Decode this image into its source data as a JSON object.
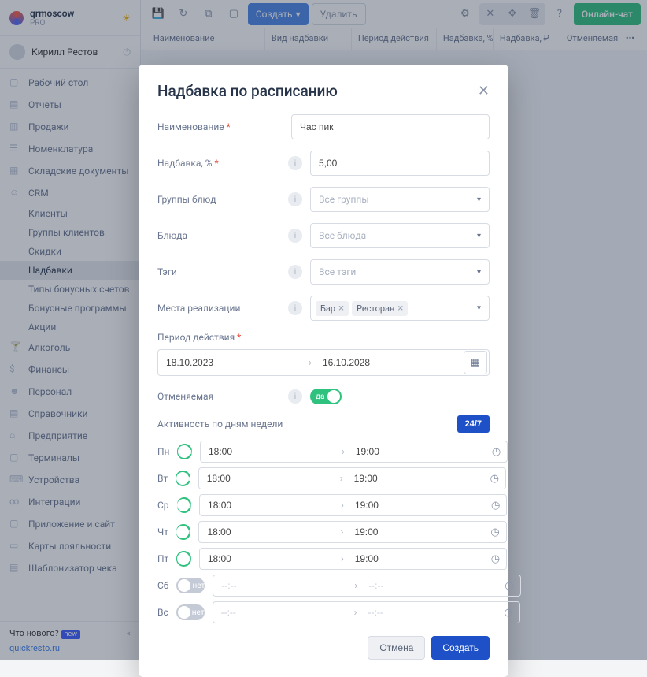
{
  "header": {
    "account": "qrmoscow",
    "plan": "PRO",
    "user": "Кирилл Рестов"
  },
  "nav": {
    "items": [
      {
        "label": "Рабочий стол"
      },
      {
        "label": "Отчеты"
      },
      {
        "label": "Продажи"
      },
      {
        "label": "Номенклатура"
      },
      {
        "label": "Складские документы"
      },
      {
        "label": "CRM"
      },
      {
        "label": "Алкоголь"
      },
      {
        "label": "Финансы"
      },
      {
        "label": "Персонал"
      },
      {
        "label": "Справочники"
      },
      {
        "label": "Предприятие"
      },
      {
        "label": "Терминалы"
      },
      {
        "label": "Устройства"
      },
      {
        "label": "Интеграции"
      },
      {
        "label": "Приложение и сайт"
      },
      {
        "label": "Карты лояльности"
      },
      {
        "label": "Шаблонизатор чека"
      }
    ],
    "crm_sub": [
      {
        "label": "Клиенты"
      },
      {
        "label": "Группы клиентов"
      },
      {
        "label": "Скидки"
      },
      {
        "label": "Надбавки"
      },
      {
        "label": "Типы бонусных счетов"
      },
      {
        "label": "Бонусные программы"
      },
      {
        "label": "Акции"
      }
    ]
  },
  "footer": {
    "whatsnew": "Что нового?",
    "badge": "new",
    "domain": "quickresto.ru"
  },
  "toolbar": {
    "create": "Создать",
    "delete": "Удалить",
    "chat": "Онлайн-чат"
  },
  "columns": [
    "Наименование",
    "Вид надбавки",
    "Период действия",
    "Надбавка, %",
    "Надбавка, ₽",
    "Отменяемая"
  ],
  "modal": {
    "title": "Надбавка по расписанию",
    "labels": {
      "name": "Наименование",
      "percent": "Надбавка, %",
      "groups": "Группы блюд",
      "dishes": "Блюда",
      "tags": "Тэги",
      "places": "Места реализации",
      "period": "Период действия",
      "cancelable": "Отменяемая",
      "activity": "Активность по дням недели"
    },
    "values": {
      "name": "Час пик",
      "percent": "5,00",
      "date_from": "18.10.2023",
      "date_to": "16.10.2028"
    },
    "placeholders": {
      "groups": "Все группы",
      "dishes": "Все блюда",
      "tags": "Все тэги",
      "time_empty": "--:--"
    },
    "chips": [
      "Бар",
      "Ресторан"
    ],
    "toggle_on": "да",
    "toggle_off": "нет",
    "btn247": "24/7",
    "days": [
      {
        "name": "Пн",
        "active": true,
        "from": "18:00",
        "to": "19:00"
      },
      {
        "name": "Вт",
        "active": true,
        "from": "18:00",
        "to": "19:00"
      },
      {
        "name": "Ср",
        "active": true,
        "from": "18:00",
        "to": "19:00"
      },
      {
        "name": "Чт",
        "active": true,
        "from": "18:00",
        "to": "19:00"
      },
      {
        "name": "Пт",
        "active": true,
        "from": "18:00",
        "to": "19:00"
      },
      {
        "name": "Сб",
        "active": false,
        "from": "",
        "to": ""
      },
      {
        "name": "Вс",
        "active": false,
        "from": "",
        "to": ""
      }
    ],
    "btn_cancel": "Отмена",
    "btn_create": "Создать"
  }
}
